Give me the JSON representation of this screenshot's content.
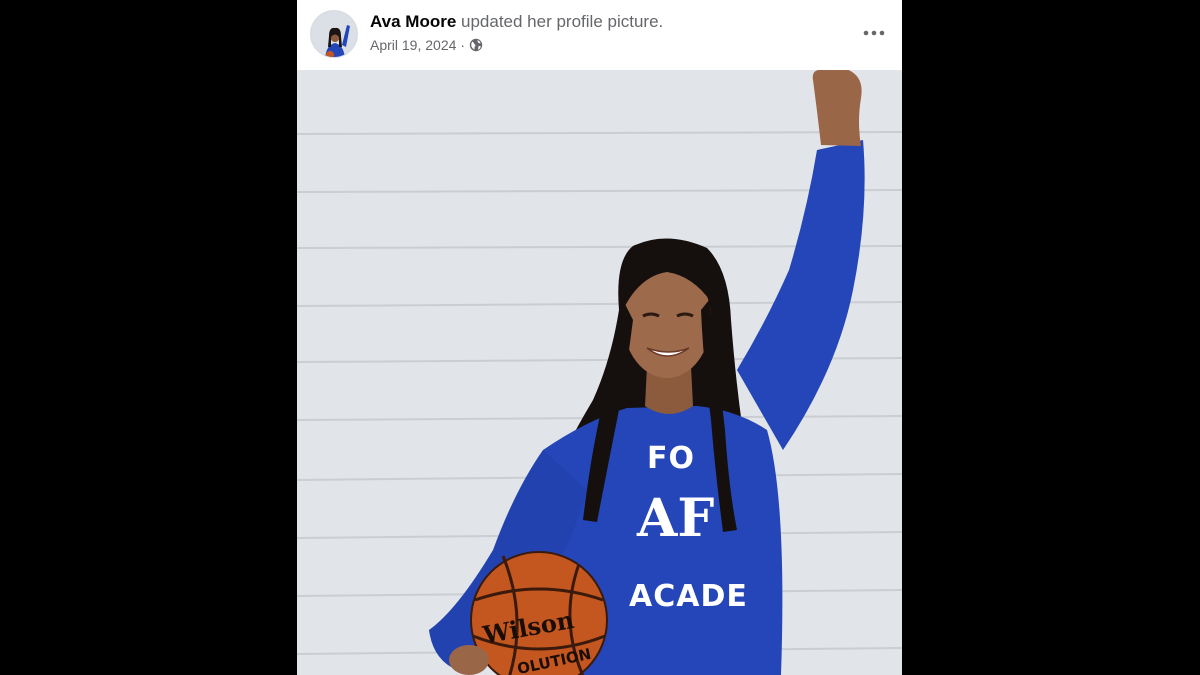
{
  "post": {
    "author": "Ava Moore",
    "action": " updated her profile picture.",
    "date": "April 19, 2024",
    "separator": "·",
    "audience_icon": "globe-icon",
    "menu_icon": "more-options-icon"
  },
  "photo": {
    "sweatshirt_text_top": "FO",
    "sweatshirt_monogram": "AF",
    "sweatshirt_text_bottom": "ACADE",
    "ball_brand": "Wilson",
    "ball_text_lower": "OLUTION"
  },
  "colors": {
    "background": "#000000",
    "card": "#ffffff",
    "name": "#050505",
    "secondary_text": "#65676b",
    "siding": "#dde1e5",
    "sweatshirt": "#2446b8",
    "basketball": "#c4561f"
  }
}
